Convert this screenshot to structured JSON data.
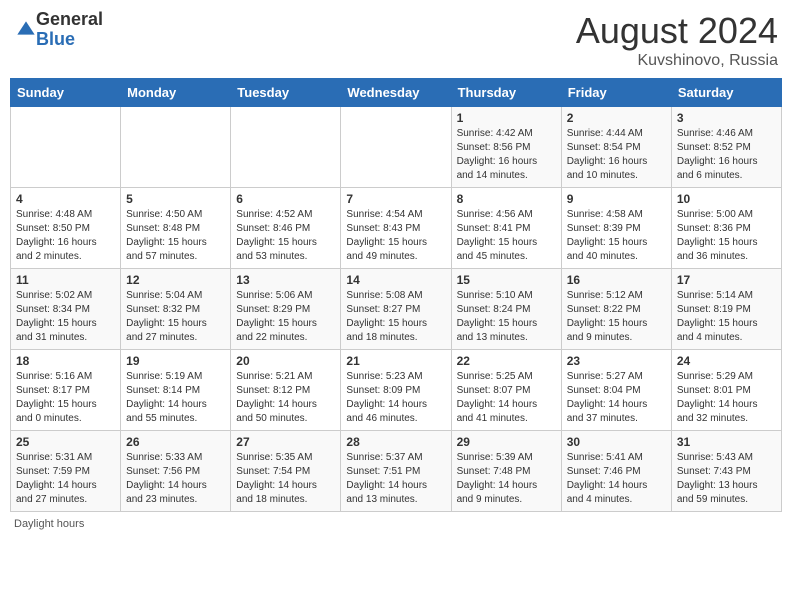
{
  "header": {
    "logo_general": "General",
    "logo_blue": "Blue",
    "month_year": "August 2024",
    "location": "Kuvshinovo, Russia"
  },
  "weekdays": [
    "Sunday",
    "Monday",
    "Tuesday",
    "Wednesday",
    "Thursday",
    "Friday",
    "Saturday"
  ],
  "footer": {
    "daylight_hours": "Daylight hours"
  },
  "weeks": [
    [
      {
        "day": "",
        "sunrise": "",
        "sunset": "",
        "daylight": ""
      },
      {
        "day": "",
        "sunrise": "",
        "sunset": "",
        "daylight": ""
      },
      {
        "day": "",
        "sunrise": "",
        "sunset": "",
        "daylight": ""
      },
      {
        "day": "",
        "sunrise": "",
        "sunset": "",
        "daylight": ""
      },
      {
        "day": "1",
        "sunrise": "Sunrise: 4:42 AM",
        "sunset": "Sunset: 8:56 PM",
        "daylight": "Daylight: 16 hours and 14 minutes."
      },
      {
        "day": "2",
        "sunrise": "Sunrise: 4:44 AM",
        "sunset": "Sunset: 8:54 PM",
        "daylight": "Daylight: 16 hours and 10 minutes."
      },
      {
        "day": "3",
        "sunrise": "Sunrise: 4:46 AM",
        "sunset": "Sunset: 8:52 PM",
        "daylight": "Daylight: 16 hours and 6 minutes."
      }
    ],
    [
      {
        "day": "4",
        "sunrise": "Sunrise: 4:48 AM",
        "sunset": "Sunset: 8:50 PM",
        "daylight": "Daylight: 16 hours and 2 minutes."
      },
      {
        "day": "5",
        "sunrise": "Sunrise: 4:50 AM",
        "sunset": "Sunset: 8:48 PM",
        "daylight": "Daylight: 15 hours and 57 minutes."
      },
      {
        "day": "6",
        "sunrise": "Sunrise: 4:52 AM",
        "sunset": "Sunset: 8:46 PM",
        "daylight": "Daylight: 15 hours and 53 minutes."
      },
      {
        "day": "7",
        "sunrise": "Sunrise: 4:54 AM",
        "sunset": "Sunset: 8:43 PM",
        "daylight": "Daylight: 15 hours and 49 minutes."
      },
      {
        "day": "8",
        "sunrise": "Sunrise: 4:56 AM",
        "sunset": "Sunset: 8:41 PM",
        "daylight": "Daylight: 15 hours and 45 minutes."
      },
      {
        "day": "9",
        "sunrise": "Sunrise: 4:58 AM",
        "sunset": "Sunset: 8:39 PM",
        "daylight": "Daylight: 15 hours and 40 minutes."
      },
      {
        "day": "10",
        "sunrise": "Sunrise: 5:00 AM",
        "sunset": "Sunset: 8:36 PM",
        "daylight": "Daylight: 15 hours and 36 minutes."
      }
    ],
    [
      {
        "day": "11",
        "sunrise": "Sunrise: 5:02 AM",
        "sunset": "Sunset: 8:34 PM",
        "daylight": "Daylight: 15 hours and 31 minutes."
      },
      {
        "day": "12",
        "sunrise": "Sunrise: 5:04 AM",
        "sunset": "Sunset: 8:32 PM",
        "daylight": "Daylight: 15 hours and 27 minutes."
      },
      {
        "day": "13",
        "sunrise": "Sunrise: 5:06 AM",
        "sunset": "Sunset: 8:29 PM",
        "daylight": "Daylight: 15 hours and 22 minutes."
      },
      {
        "day": "14",
        "sunrise": "Sunrise: 5:08 AM",
        "sunset": "Sunset: 8:27 PM",
        "daylight": "Daylight: 15 hours and 18 minutes."
      },
      {
        "day": "15",
        "sunrise": "Sunrise: 5:10 AM",
        "sunset": "Sunset: 8:24 PM",
        "daylight": "Daylight: 15 hours and 13 minutes."
      },
      {
        "day": "16",
        "sunrise": "Sunrise: 5:12 AM",
        "sunset": "Sunset: 8:22 PM",
        "daylight": "Daylight: 15 hours and 9 minutes."
      },
      {
        "day": "17",
        "sunrise": "Sunrise: 5:14 AM",
        "sunset": "Sunset: 8:19 PM",
        "daylight": "Daylight: 15 hours and 4 minutes."
      }
    ],
    [
      {
        "day": "18",
        "sunrise": "Sunrise: 5:16 AM",
        "sunset": "Sunset: 8:17 PM",
        "daylight": "Daylight: 15 hours and 0 minutes."
      },
      {
        "day": "19",
        "sunrise": "Sunrise: 5:19 AM",
        "sunset": "Sunset: 8:14 PM",
        "daylight": "Daylight: 14 hours and 55 minutes."
      },
      {
        "day": "20",
        "sunrise": "Sunrise: 5:21 AM",
        "sunset": "Sunset: 8:12 PM",
        "daylight": "Daylight: 14 hours and 50 minutes."
      },
      {
        "day": "21",
        "sunrise": "Sunrise: 5:23 AM",
        "sunset": "Sunset: 8:09 PM",
        "daylight": "Daylight: 14 hours and 46 minutes."
      },
      {
        "day": "22",
        "sunrise": "Sunrise: 5:25 AM",
        "sunset": "Sunset: 8:07 PM",
        "daylight": "Daylight: 14 hours and 41 minutes."
      },
      {
        "day": "23",
        "sunrise": "Sunrise: 5:27 AM",
        "sunset": "Sunset: 8:04 PM",
        "daylight": "Daylight: 14 hours and 37 minutes."
      },
      {
        "day": "24",
        "sunrise": "Sunrise: 5:29 AM",
        "sunset": "Sunset: 8:01 PM",
        "daylight": "Daylight: 14 hours and 32 minutes."
      }
    ],
    [
      {
        "day": "25",
        "sunrise": "Sunrise: 5:31 AM",
        "sunset": "Sunset: 7:59 PM",
        "daylight": "Daylight: 14 hours and 27 minutes."
      },
      {
        "day": "26",
        "sunrise": "Sunrise: 5:33 AM",
        "sunset": "Sunset: 7:56 PM",
        "daylight": "Daylight: 14 hours and 23 minutes."
      },
      {
        "day": "27",
        "sunrise": "Sunrise: 5:35 AM",
        "sunset": "Sunset: 7:54 PM",
        "daylight": "Daylight: 14 hours and 18 minutes."
      },
      {
        "day": "28",
        "sunrise": "Sunrise: 5:37 AM",
        "sunset": "Sunset: 7:51 PM",
        "daylight": "Daylight: 14 hours and 13 minutes."
      },
      {
        "day": "29",
        "sunrise": "Sunrise: 5:39 AM",
        "sunset": "Sunset: 7:48 PM",
        "daylight": "Daylight: 14 hours and 9 minutes."
      },
      {
        "day": "30",
        "sunrise": "Sunrise: 5:41 AM",
        "sunset": "Sunset: 7:46 PM",
        "daylight": "Daylight: 14 hours and 4 minutes."
      },
      {
        "day": "31",
        "sunrise": "Sunrise: 5:43 AM",
        "sunset": "Sunset: 7:43 PM",
        "daylight": "Daylight: 13 hours and 59 minutes."
      }
    ]
  ]
}
